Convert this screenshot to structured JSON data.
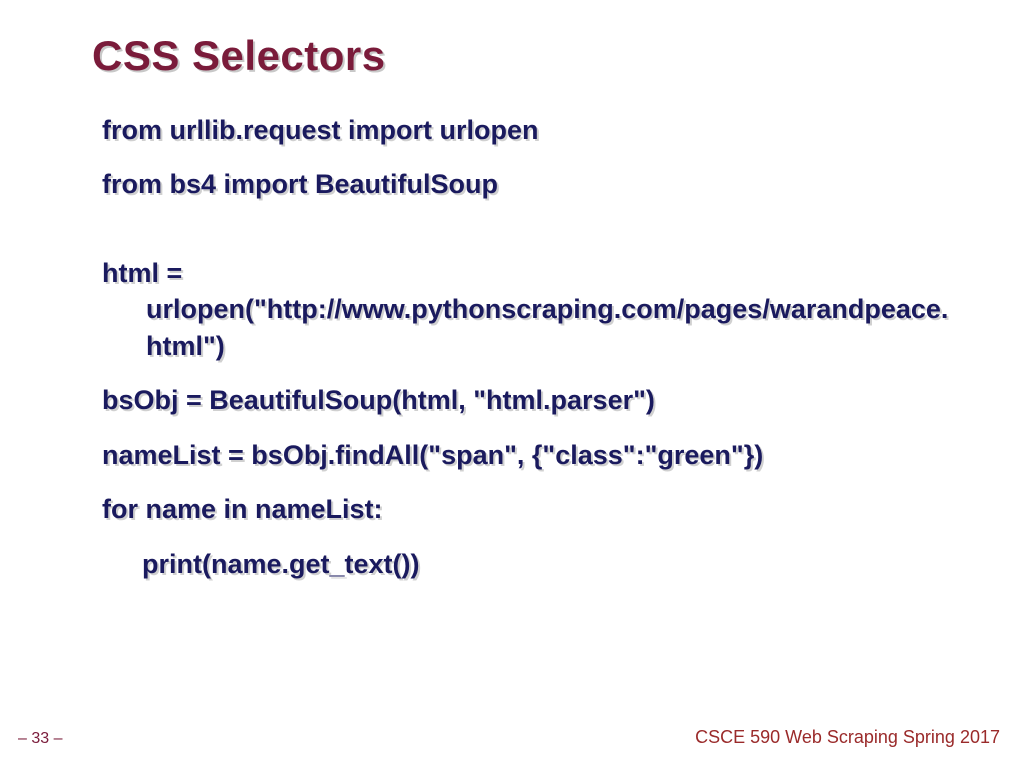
{
  "title": "CSS Selectors",
  "code": {
    "l1": "from urllib.request import urlopen",
    "l2": "from bs4 import BeautifulSoup",
    "l3": "html = urlopen(\"http://www.pythonscraping.com/pages/warandpeace.html\")",
    "l4": "bsObj = BeautifulSoup(html, \"html.parser\")",
    "l5": "nameList = bsObj.findAll(\"span\", {\"class\":\"green\"})",
    "l6": "for name in nameList:",
    "l7": "print(name.get_text())"
  },
  "page_number": "– 33 –",
  "footer": "CSCE 590 Web Scraping Spring 2017"
}
